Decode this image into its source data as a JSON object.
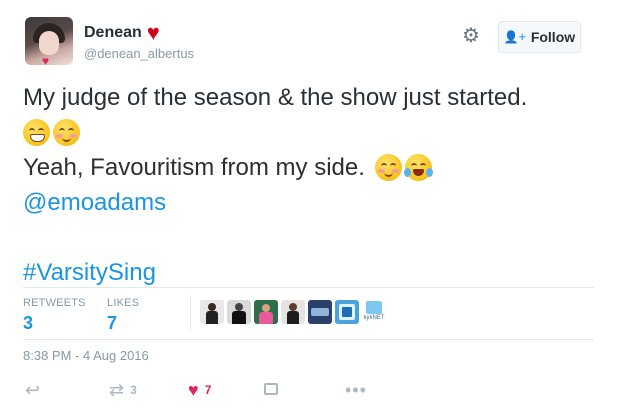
{
  "author": {
    "display_name": "Denean",
    "name_badge_icon": "heart-icon",
    "handle": "@denean_albertus"
  },
  "header": {
    "settings_icon": "gear-icon",
    "follow_label": "Follow",
    "follow_icon": "add-user-icon"
  },
  "tweet": {
    "line1": "My judge of the season & the show just started.",
    "line3": "Yeah, Favouritism from my side.",
    "mention": "@emoadams",
    "hashtag": "#VarsitySing",
    "emoji_line2": [
      "grinning-face-emoji",
      "smiling-face-emoji"
    ],
    "emoji_line3": [
      "smiling-face-emoji",
      "tears-of-joy-emoji"
    ]
  },
  "stats": {
    "retweets_label": "RETWEETS",
    "retweets_count": "3",
    "likes_label": "LIKES",
    "likes_count": "7",
    "likers": [
      {
        "name": "liker-avatar-1",
        "color": "#e9e6e6"
      },
      {
        "name": "liker-avatar-2",
        "color": "#d9d9d9"
      },
      {
        "name": "liker-avatar-3",
        "color": "#2f6e4a"
      },
      {
        "name": "liker-avatar-4",
        "color": "#e6e3e3"
      },
      {
        "name": "liker-avatar-5",
        "color": "#2b3f6b"
      },
      {
        "name": "liker-avatar-6",
        "color": "#4aa3df"
      },
      {
        "name": "liker-avatar-7",
        "color": "#7cc8ee",
        "caption": "kykNET"
      }
    ]
  },
  "timestamp": "8:38 PM - 4 Aug 2016",
  "actions": {
    "reply_icon": "reply-icon",
    "retweet_icon": "retweet-icon",
    "retweet_count": "3",
    "like_icon": "heart-icon",
    "like_count": "7",
    "media_icon": "image-icon",
    "more_icon": "more-icon"
  },
  "colors": {
    "accent": "#1b95e0",
    "like": "#e0245e",
    "muted": "#8899a6"
  }
}
